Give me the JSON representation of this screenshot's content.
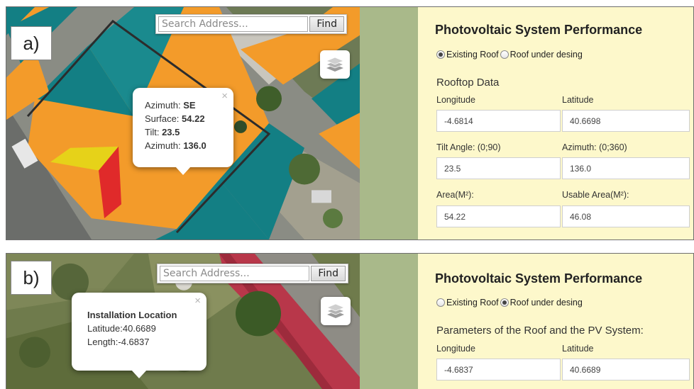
{
  "panel_a": {
    "label": "a)",
    "search": {
      "placeholder": "Search Address...",
      "find_label": "Find"
    },
    "popup": {
      "close": "×",
      "rows": [
        {
          "key": "Azimuth: ",
          "value": "SE"
        },
        {
          "key": "Surface: ",
          "value": "54.22"
        },
        {
          "key": "Tilt: ",
          "value": "23.5"
        },
        {
          "key": "Azimuth: ",
          "value": "136.0"
        }
      ]
    },
    "form": {
      "title": "Photovoltaic System Performance",
      "radio_existing": "Existing Roof",
      "radio_under": "Roof under desing",
      "selected": "existing",
      "section": "Rooftop Data",
      "fields": {
        "longitude": {
          "label": "Longitude",
          "value": "-4.6814"
        },
        "latitude": {
          "label": "Latitude",
          "value": "40.6698"
        },
        "tilt": {
          "label": "Tilt Angle: (0;90)",
          "value": "23.5"
        },
        "azimuth": {
          "label": "Azimuth: (0;360)",
          "value": "136.0"
        },
        "area": {
          "label": "Area(M²):",
          "value": "54.22"
        },
        "usable_area": {
          "label": "Usable Area(M²):",
          "value": "46.08"
        }
      }
    }
  },
  "panel_b": {
    "label": "b)",
    "search": {
      "placeholder": "Search Address...",
      "find_label": "Find"
    },
    "popup": {
      "close": "×",
      "title": "Installation Location",
      "latitude": "Latitude:40.6689",
      "length": "Length:-4.6837"
    },
    "form": {
      "title": "Photovoltaic System Performance",
      "radio_existing": "Existing Roof",
      "radio_under": "Roof under desing",
      "selected": "under",
      "section": "Parameters of the Roof and the PV System:",
      "fields": {
        "longitude": {
          "label": "Longitude",
          "value": "-4.6837"
        },
        "latitude": {
          "label": "Latitude",
          "value": "40.6689"
        }
      }
    }
  },
  "colors": {
    "roof_orange": "#f39b2a",
    "roof_teal": "#137f84",
    "roof_yellow": "#e6d219",
    "roof_red": "#e02a2a",
    "strip_green": "#a9b98a",
    "form_bg": "#fdf8cb"
  },
  "icons": {
    "layers": "layers-icon",
    "close": "close-icon"
  }
}
